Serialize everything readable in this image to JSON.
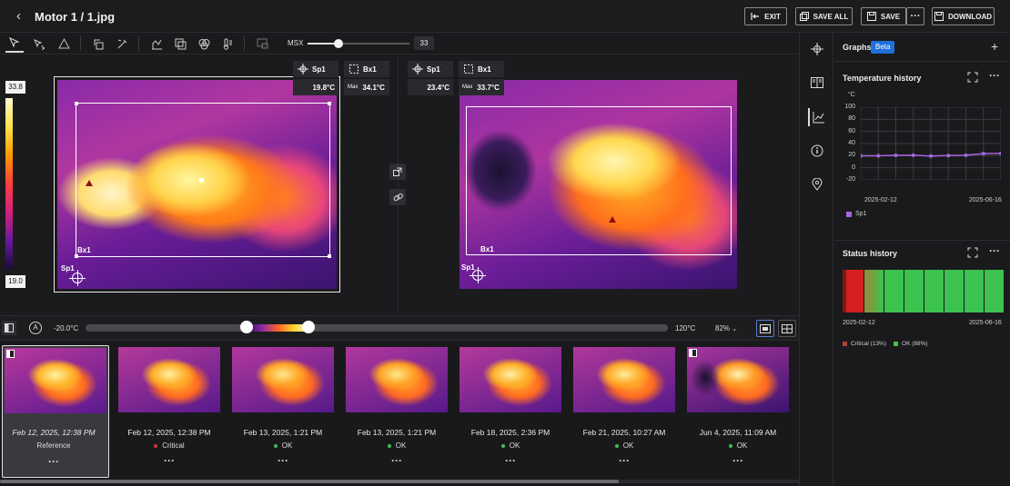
{
  "header": {
    "title": "Motor 1 / 1.jpg",
    "exit_label": "EXIT",
    "save_all_label": "SAVE ALL",
    "save_label": "SAVE",
    "more_label": "···",
    "download_label": "DOWNLOAD"
  },
  "toolbar": {
    "msx_label": "MSX",
    "msx_value": "33",
    "msx_fraction": 0.3
  },
  "scale": {
    "max": "33.8",
    "min": "19.0"
  },
  "left_image": {
    "spot_label": "Sp1",
    "spot_value": "19.8°C",
    "box_label": "Bx1",
    "box_max_label": "Max",
    "box_max_value": "34.1°C",
    "image_box_label": "Bx1",
    "image_spot_label": "Sp1"
  },
  "right_image": {
    "spot_label": "Sp1",
    "spot_value": "23.4°C",
    "box_label": "Bx1",
    "box_max_label": "Max",
    "box_max_value": "33.7°C",
    "image_box_label": "Bx1",
    "image_spot_label": "Sp1"
  },
  "temp_control": {
    "auto_label": "A",
    "min_label": "-20.0°C",
    "max_label": "120°C",
    "zoom_label": "82%"
  },
  "thumbnails": [
    {
      "date": "Feb 12, 2025, 12:38 PM",
      "status": "Reference",
      "status_color": "",
      "more": "···",
      "selected": true
    },
    {
      "date": "Feb 12, 2025, 12:38 PM",
      "status": "Critical",
      "status_color": "#c0392b",
      "more": "···"
    },
    {
      "date": "Feb 13, 2025, 1:21 PM",
      "status": "OK",
      "status_color": "#3cc24f",
      "more": "···"
    },
    {
      "date": "Feb 13, 2025, 1:21 PM",
      "status": "OK",
      "status_color": "#3cc24f",
      "more": "···"
    },
    {
      "date": "Feb 18, 2025, 2:36 PM",
      "status": "OK",
      "status_color": "#3cc24f",
      "more": "···"
    },
    {
      "date": "Feb 21, 2025, 10:27 AM",
      "status": "OK",
      "status_color": "#3cc24f",
      "more": "···"
    },
    {
      "date": "Jun 4, 2025, 11:09 AM",
      "status": "OK",
      "status_color": "#3cc24f",
      "more": "···"
    }
  ],
  "panel": {
    "title": "Graphs",
    "badge": "Beta",
    "add_label": "+",
    "temp_history": {
      "title": "Temperature history",
      "start_label": "2025-02-12",
      "end_label": "2025-06-16"
    },
    "status_history": {
      "title": "Status history",
      "start_label": "2025-02-12",
      "end_label": "2025-06-16",
      "legend_critical": "Critical (13%)",
      "legend_ok": "OK (88%)"
    }
  },
  "chart_data": [
    {
      "type": "line",
      "title": "Temperature history",
      "ylabel": "°C",
      "yticks": [
        "100",
        "80",
        "60",
        "40",
        "20",
        "0",
        "-20"
      ],
      "ylim": [
        -20,
        100
      ],
      "x": [
        "2025-02-12",
        "",
        "",
        "",
        "",
        "",
        "",
        "",
        "2025-06-16"
      ],
      "series": [
        {
          "name": "Sp1",
          "color": "#a766e0",
          "values": [
            19.8,
            19.8,
            20.5,
            20.6,
            19.4,
            20.1,
            20.7,
            23.4,
            23.6
          ]
        }
      ],
      "grid": true,
      "legend": "bottom-left"
    },
    {
      "type": "bar",
      "title": "Status history",
      "x_start": "2025-02-12",
      "x_end": "2025-06-16",
      "segments": [
        {
          "status": "Critical",
          "color": "#d42020"
        },
        {
          "status": "OK",
          "color": "#3cc24f"
        },
        {
          "status": "OK",
          "color": "#3cc24f"
        },
        {
          "status": "OK",
          "color": "#3cc24f"
        },
        {
          "status": "OK",
          "color": "#3cc24f"
        },
        {
          "status": "OK",
          "color": "#3cc24f"
        },
        {
          "status": "OK",
          "color": "#3cc24f"
        },
        {
          "status": "OK",
          "color": "#3cc24f"
        }
      ],
      "legend": [
        {
          "label": "Critical (13%)",
          "color": "#b0443a"
        },
        {
          "label": "OK (88%)",
          "color": "#3cc24f"
        }
      ]
    }
  ]
}
